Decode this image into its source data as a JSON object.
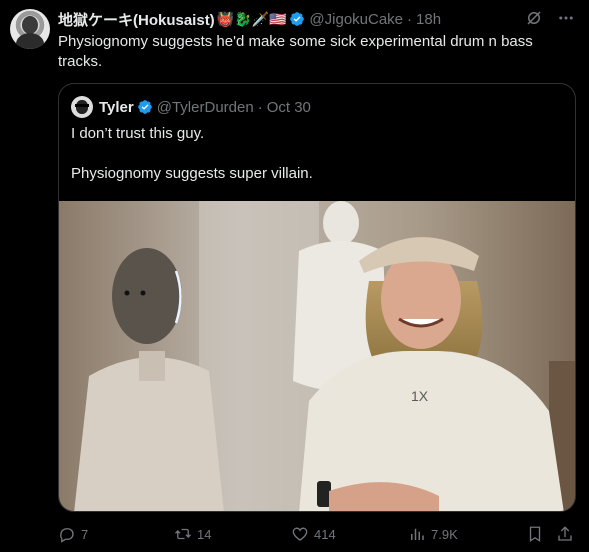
{
  "tweet": {
    "author_name": "地獄ケーキ(Hokusaist)",
    "author_emoji": "👹🐉🗡️🇺🇸",
    "handle": "@JigokuCake",
    "separator": "·",
    "time": "18h",
    "text": "Physiognomy suggests he'd make some sick experimental drum n bass tracks."
  },
  "quoted": {
    "author_name": "Tyler",
    "handle": "@TylerDurden",
    "separator": "·",
    "time": "Oct 30",
    "line1": "I don’t trust this guy.",
    "line2": "Physiognomy suggests super villain.",
    "shirt_logo": "1X"
  },
  "actions": {
    "replies": "7",
    "retweets": "14",
    "likes": "414",
    "views": "7.9K"
  },
  "colors": {
    "verified": "#1d9bf0",
    "muted": "#71767b",
    "border": "#2f3336"
  },
  "icons": [
    "grok-icon",
    "more-icon",
    "reply-icon",
    "retweet-icon",
    "like-icon",
    "views-icon",
    "bookmark-icon",
    "share-icon",
    "verified-badge-icon"
  ]
}
